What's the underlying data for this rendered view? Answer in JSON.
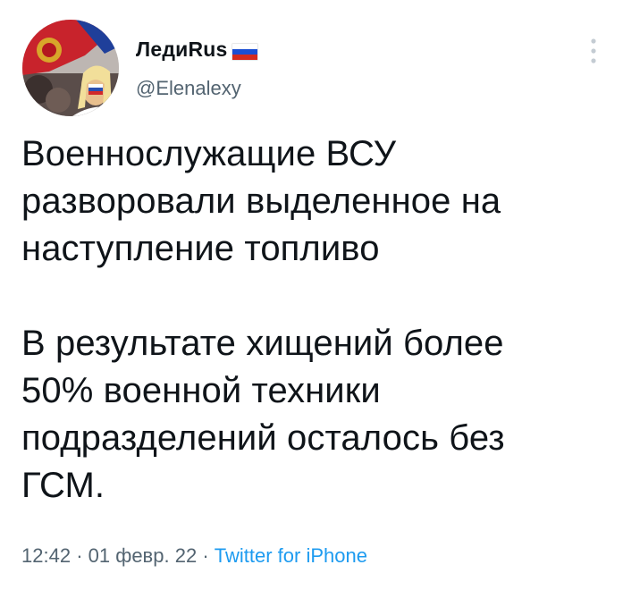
{
  "author": {
    "display_name": "ЛедиRus",
    "handle": "@Elenalexy",
    "name_badge": "russian-flag-emoji"
  },
  "tweet": {
    "text": "Военнослужащие ВСУ\nразворовали выделенное на\nнаступление топливо\n\nВ результате хищений более\n50% военной техники\nподразделений осталось без\nГСМ.",
    "time": "12:42",
    "separator_1": "·",
    "date": "01 февр. 22",
    "separator_2": "·",
    "source": "Twitter for iPhone"
  },
  "colors": {
    "text_primary": "#0f1419",
    "text_secondary": "#536471",
    "link": "#1d9bf0",
    "background": "#ffffff"
  },
  "icons": {
    "more": "more-vertical-icon"
  }
}
